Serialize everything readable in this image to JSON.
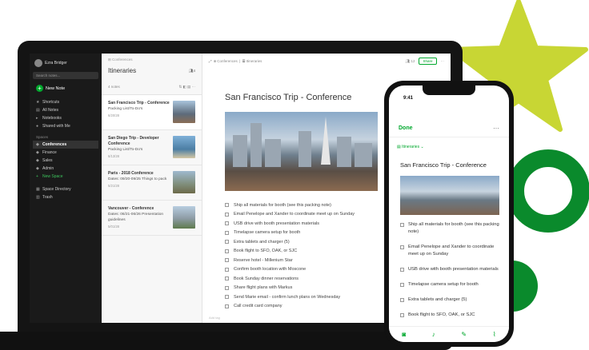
{
  "sidebar": {
    "account_name": "Ezra Bridger",
    "search_placeholder": "Search notes...",
    "new_note": "New Note",
    "nav": [
      "Shortcuts",
      "All Notes",
      "Notebooks",
      "Shared with Me"
    ],
    "spaces_label": "Spaces",
    "spaces": [
      "Conferences",
      "Finance",
      "Sales",
      "Admin"
    ],
    "new_space": "New Space",
    "bottom": [
      "Space Directory",
      "Trash"
    ]
  },
  "notelist": {
    "breadcrumb": "Conferences",
    "title": "Itineraries",
    "share_count": "4",
    "count": "4 notes",
    "notes": [
      {
        "title": "San Francisco Trip - Conference",
        "snippet": "Packing List/To-Do's",
        "date": "6/20/28"
      },
      {
        "title": "San Diego Trip - Developer Conference",
        "snippet": "Packing List/To-Do's",
        "date": "6/13/28"
      },
      {
        "title": "Paris - 2018 Conference",
        "snippet": "Dates: 09/20-09/25 Things to pack",
        "date": "5/21/28"
      },
      {
        "title": "Vancouver - Conference",
        "snippet": "Dates: 06/21-06/26 Presentation guidelines",
        "date": "5/01/28"
      }
    ]
  },
  "editor": {
    "crumb_space": "Conferences",
    "crumb_notebook": "Itineraries",
    "share_count": "12",
    "share_label": "Share",
    "more": "···",
    "title": "San Francisco Trip - Conference",
    "todos": [
      "Ship all materials for booth (see this packing note)",
      "Email Penelope and Xander to coordinate meet up on Sunday",
      "USB drive with booth presentation materials",
      "Timelapse camera setup for booth",
      "Extra tablets and charger (5)",
      "Book flight to SFO, OAK, or SJC",
      "Reserve hotel - Millenium Star",
      "Confirm booth location with Moscone",
      "Book Sunday dinner reservations",
      "Share flight plans with Markus",
      "Send Marie email - confirm lunch plans on Wednesday",
      "Call credit card company"
    ],
    "footer": "Add tag"
  },
  "phone": {
    "time": "9:41",
    "done": "Done",
    "more": "···",
    "notebook": "Itineraries",
    "title": "San Francisco Trip - Conference",
    "todos": [
      "Ship all materials for booth (see this packing note)",
      "Email Penelope and Xander to coordinate meet up on Sunday",
      "USB drive with booth presentation materials",
      "Timelapse camera setup for booth",
      "Extra tablets and charger (5)",
      "Book flight to SFO, OAK, or SJC"
    ]
  },
  "colors": {
    "brand_green": "#00a82d",
    "star_yellow": "#c8d634",
    "shape_green": "#0a8a2c"
  }
}
